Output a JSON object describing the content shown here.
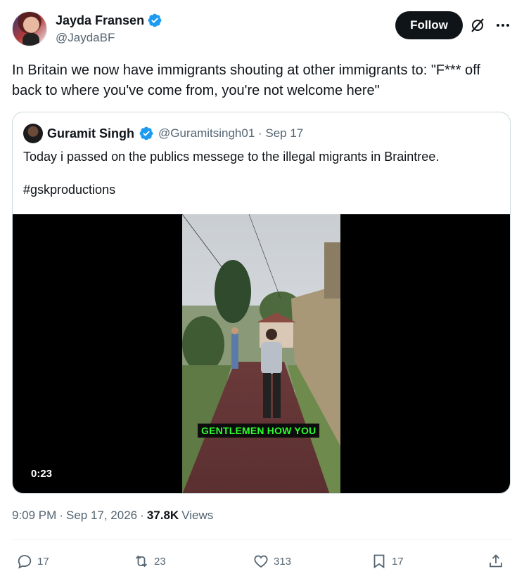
{
  "author": {
    "display_name": "Jayda Fransen",
    "handle": "@JaydaBF",
    "verified": true
  },
  "follow_label": "Follow",
  "tweet_text": "In Britain we now have immigrants shouting at other immigrants to: \"F*** off back to where you've come from, you're not welcome here\"",
  "quote": {
    "display_name": "Guramit Singh",
    "handle_date": "@Guramitsingh01 · Sep 17",
    "text": "Today i passed on the publics messege to the illegal migrants in Braintree.",
    "hashtag": "#gskproductions",
    "video": {
      "duration": "0:23",
      "caption": "GENTLEMEN HOW YOU"
    }
  },
  "meta": {
    "time": "9:09 PM",
    "date": "Sep 17, 2026",
    "views_count": "37.8K",
    "views_label": "Views"
  },
  "actions": {
    "replies": "17",
    "reposts": "23",
    "likes": "313",
    "bookmarks": "17"
  },
  "colors": {
    "verified_blue": "#1d9bf0",
    "caption_green": "#2cff2c",
    "text_secondary": "#536471"
  }
}
